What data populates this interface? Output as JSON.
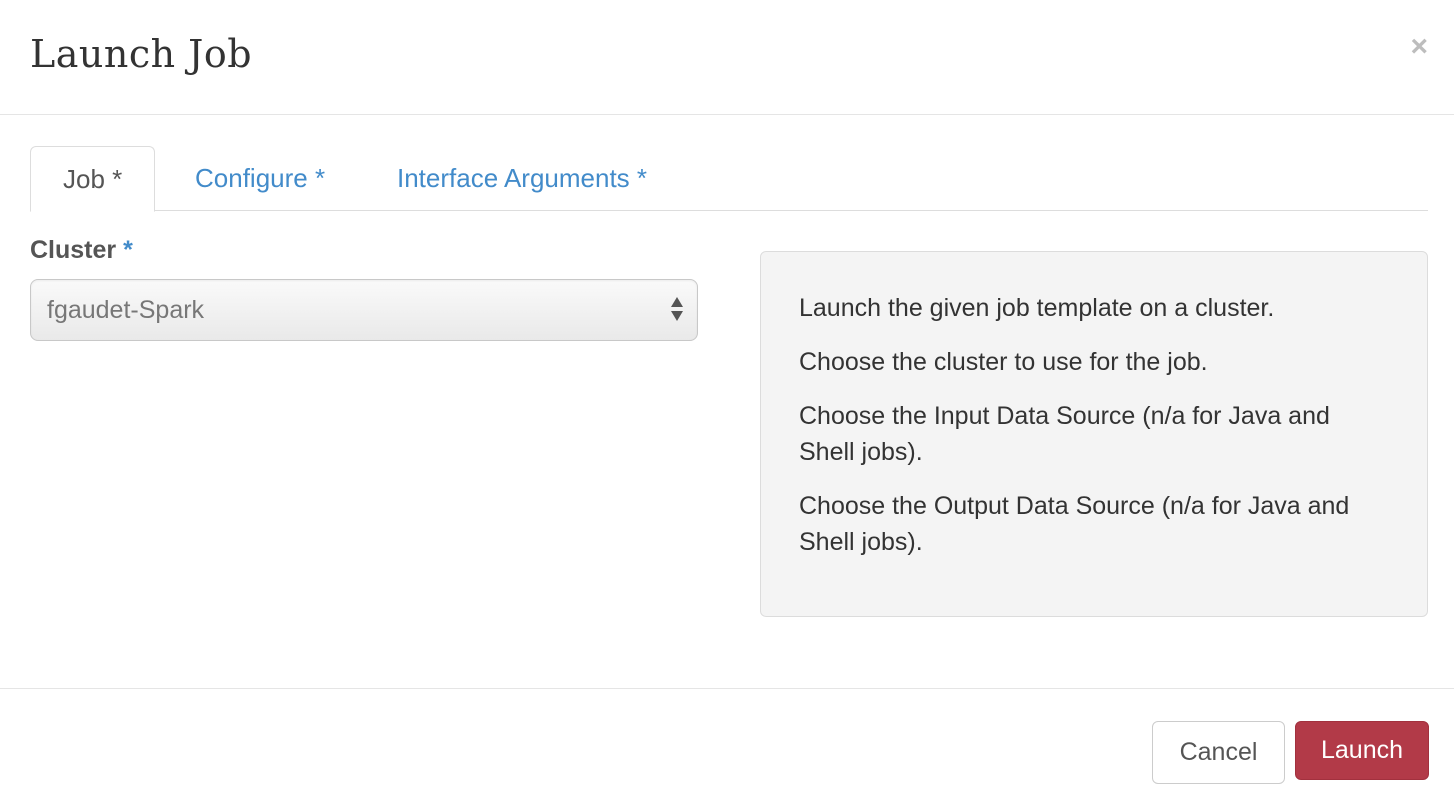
{
  "modal": {
    "title": "Launch Job",
    "close_symbol": "×"
  },
  "tabs": [
    {
      "label": "Job *",
      "active": true
    },
    {
      "label": "Configure *",
      "active": false
    },
    {
      "label": "Interface Arguments *",
      "active": false
    }
  ],
  "form": {
    "cluster_label": "Cluster",
    "required_mark": "*",
    "cluster_selected": "fgaudet-Spark"
  },
  "help": {
    "lines": [
      "Launch the given job template on a cluster.",
      "Choose the cluster to use for the job.",
      "Choose the Input Data Source (n/a for Java and Shell jobs).",
      "Choose the Output Data Source (n/a for Java and Shell jobs)."
    ]
  },
  "footer": {
    "cancel_label": "Cancel",
    "launch_label": "Launch"
  },
  "colors": {
    "link_blue": "#428bca",
    "launch_red": "#b23a48",
    "panel_bg": "#f4f4f4"
  },
  "icons": {
    "close": "close-icon",
    "select_arrows": "updown-arrows-icon"
  }
}
